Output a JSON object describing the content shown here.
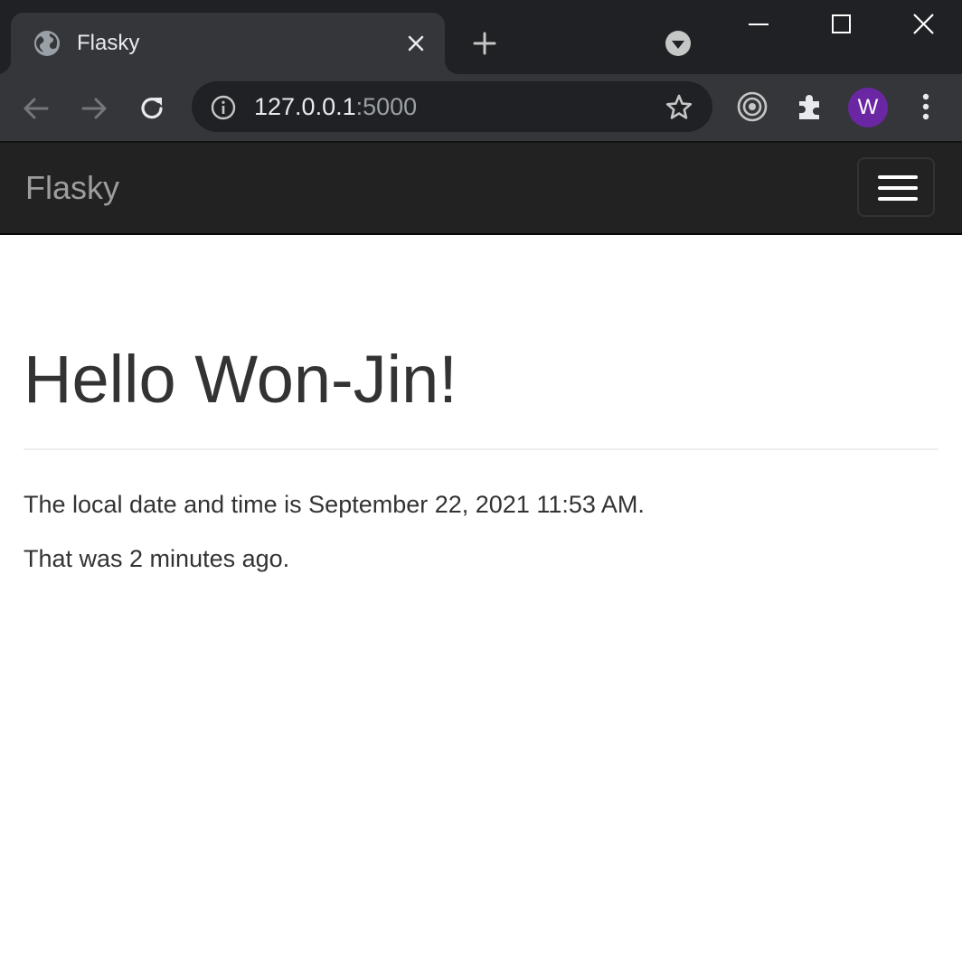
{
  "browser": {
    "tab": {
      "title": "Flasky"
    },
    "address_bar": {
      "host": "127.0.0.1",
      "port": ":5000"
    },
    "profile_initial": "W"
  },
  "navbar": {
    "brand": "Flasky"
  },
  "content": {
    "greeting": "Hello Won-Jin!",
    "local_time_text": "The local date and time is September 22, 2021 11:53 AM.",
    "relative_time_text": "That was 2 minutes ago."
  },
  "colors": {
    "chrome_dark": "#202124",
    "chrome_toolbar": "#35363a",
    "navbar_bg": "#222222",
    "brand_text": "#9d9d9d",
    "body_text": "#333333",
    "avatar_bg": "#6a26a3"
  }
}
